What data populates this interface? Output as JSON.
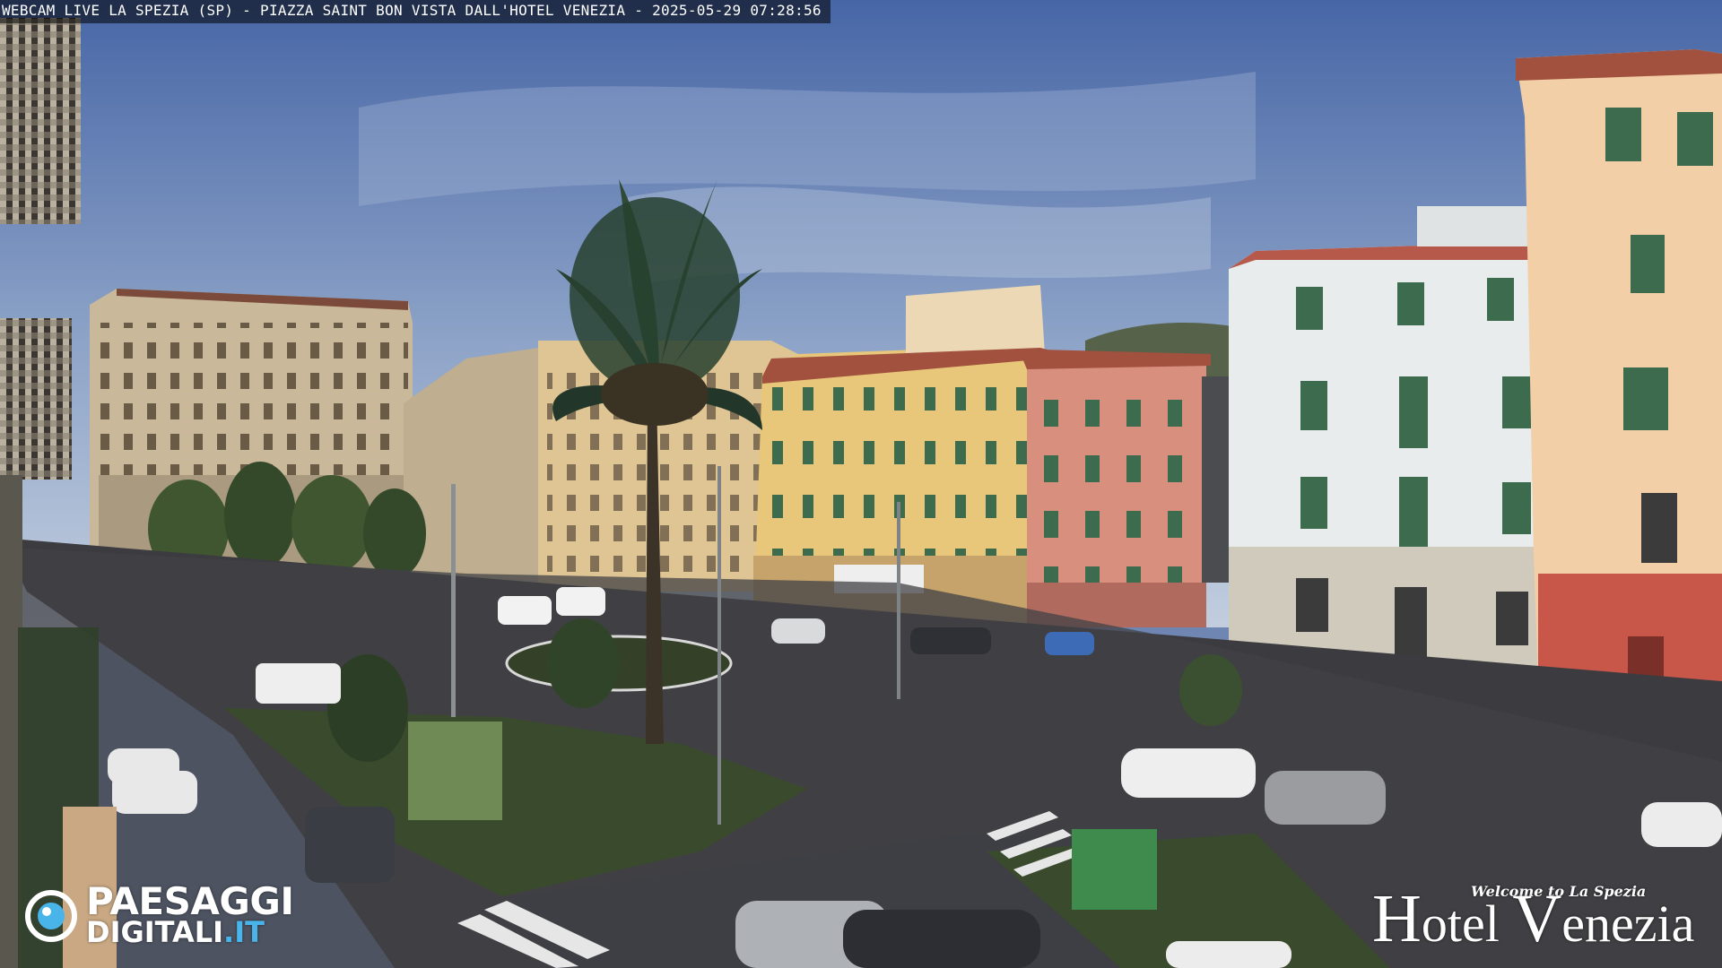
{
  "overlay": {
    "title": "WEBCAM LIVE LA SPEZIA (SP) - PIAZZA SAINT BON VISTA DALL'HOTEL VENEZIA - 2025-05-29 07:28:56"
  },
  "logos": {
    "paesaggi": {
      "line1": "PAESAGGI",
      "line2_main": "DIGITALI",
      "line2_suffix": ".IT",
      "accent_color": "#48b4ea"
    },
    "hotel": {
      "welcome": "Welcome to La Spezia",
      "name_h_cap": "H",
      "name_rest1": "otel ",
      "name_v_cap": "V",
      "name_rest2": "enezia"
    }
  },
  "colors": {
    "sky_top": "#4a68a6",
    "sky_bottom": "#b8c6da",
    "building_beige": "#c9b899",
    "building_yellow": "#e8c77a",
    "building_pink": "#d98f7e",
    "building_white": "#e9ecec",
    "building_red": "#c8574a",
    "shutter_green": "#3d6b4d",
    "road": "#3c3c40",
    "grass": "#3a4a2c",
    "palm": "#28402e"
  }
}
